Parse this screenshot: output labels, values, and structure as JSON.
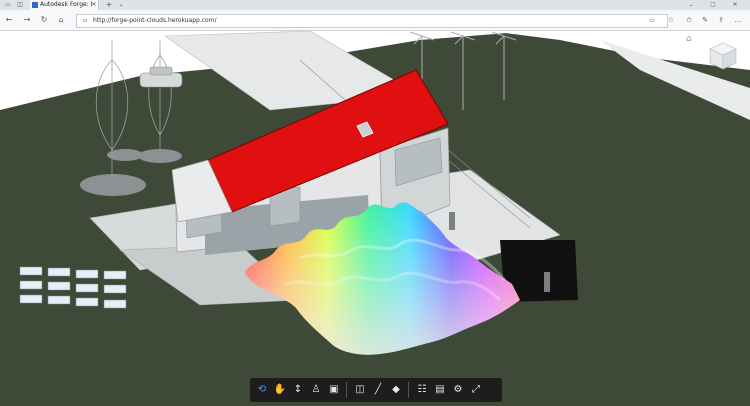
{
  "browser": {
    "tab_title": "Autodesk Forge: Point C",
    "url": "http://forge-point-clouds.herokuapp.com/",
    "icons": [
      "tab-actions-icon",
      "back-tabs-icon",
      "close-tab-icon",
      "new-tab-icon",
      "tab-list-icon",
      "back-icon",
      "forward-icon",
      "refresh-icon",
      "home-icon",
      "lock-icon",
      "reading-view-icon",
      "favorite-icon",
      "favorites-hub-icon",
      "pen-icon",
      "share-icon",
      "more-icon",
      "minimize-icon",
      "maximize-icon",
      "close-window-icon"
    ]
  },
  "viewer": {
    "colors": {
      "terrain": "#3e4a37",
      "roof": "#e11010",
      "wall": "#e4e6e7",
      "glass": "#9aa3a7"
    },
    "viewcube_icon": "view-cube-icon",
    "home_icon": "home-view-icon"
  },
  "toolbar": {
    "tools": [
      "orbit-icon",
      "pan-icon",
      "zoom-icon",
      "first-person-icon",
      "camera-icon",
      "section-icon",
      "measure-icon",
      "explode-icon",
      "model-browser-icon",
      "properties-icon",
      "settings-icon",
      "fullscreen-icon"
    ]
  }
}
